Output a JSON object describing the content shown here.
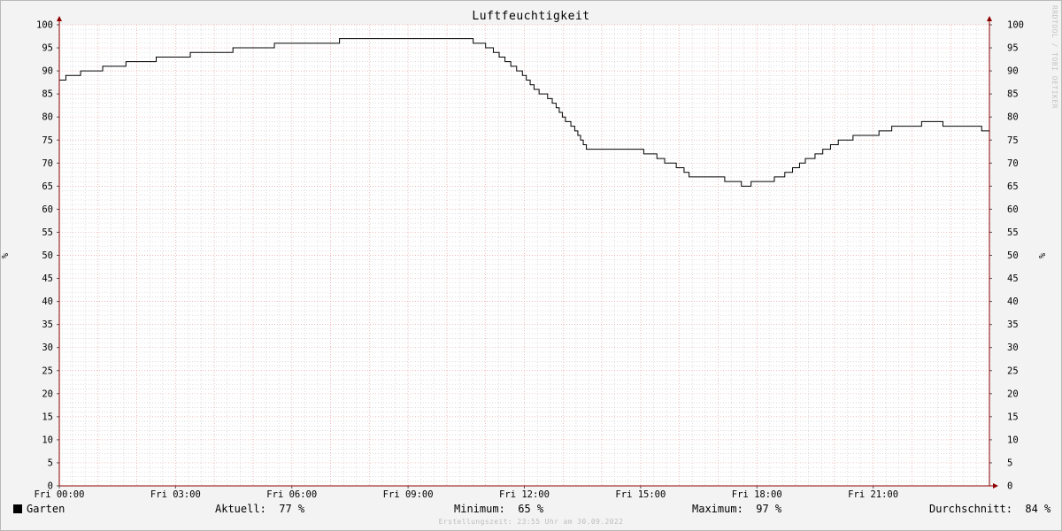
{
  "watermark": "RRDTOOL / TOBI OETIKER",
  "footer": "Erstellungszeit: 23:55 Uhr am 30.09.2022",
  "legend": {
    "series_name": "Garten",
    "current_label": "Aktuell:",
    "current_value": "77 %",
    "min_label": "Minimum:",
    "min_value": "65 %",
    "max_label": "Maximum:",
    "max_value": "97 %",
    "avg_label": "Durchschnitt:",
    "avg_value": "84 %"
  },
  "colors": {
    "line": "#000000",
    "major_grid": "#e9a0a0",
    "minor_grid": "#c8c8c8",
    "axis": "#8c0000",
    "plot_bg": "#ffffff"
  },
  "chart_data": {
    "type": "line",
    "title": "Luftfeuchtigkeit",
    "ylabel": "%",
    "ylabel_right": "%",
    "xlim": [
      0,
      24
    ],
    "ylim": [
      0,
      100
    ],
    "y_ticks": [
      0,
      5,
      10,
      15,
      20,
      25,
      30,
      35,
      40,
      45,
      50,
      55,
      60,
      65,
      70,
      75,
      80,
      85,
      90,
      95,
      100
    ],
    "x_ticks": [
      {
        "x": 0,
        "label": "Fri 00:00"
      },
      {
        "x": 3,
        "label": "Fri 03:00"
      },
      {
        "x": 6,
        "label": "Fri 06:00"
      },
      {
        "x": 9,
        "label": "Fri 09:00"
      },
      {
        "x": 12,
        "label": "Fri 12:00"
      },
      {
        "x": 15,
        "label": "Fri 15:00"
      },
      {
        "x": 18,
        "label": "Fri 18:00"
      },
      {
        "x": 21,
        "label": "Fri 21:00"
      }
    ],
    "grid": true,
    "series": [
      {
        "name": "Garten",
        "step": true,
        "points": [
          [
            0.0,
            88
          ],
          [
            0.17,
            89
          ],
          [
            0.55,
            90
          ],
          [
            1.12,
            91
          ],
          [
            1.72,
            92
          ],
          [
            2.5,
            93
          ],
          [
            3.38,
            94
          ],
          [
            4.48,
            95
          ],
          [
            5.55,
            96
          ],
          [
            7.23,
            97
          ],
          [
            10.68,
            96
          ],
          [
            11.0,
            95
          ],
          [
            11.2,
            94
          ],
          [
            11.35,
            93
          ],
          [
            11.5,
            92
          ],
          [
            11.65,
            91
          ],
          [
            11.8,
            90
          ],
          [
            11.95,
            89
          ],
          [
            12.05,
            88
          ],
          [
            12.15,
            87
          ],
          [
            12.25,
            86
          ],
          [
            12.38,
            85
          ],
          [
            12.6,
            84
          ],
          [
            12.72,
            83
          ],
          [
            12.82,
            82
          ],
          [
            12.9,
            81
          ],
          [
            12.98,
            80
          ],
          [
            13.06,
            79
          ],
          [
            13.2,
            78
          ],
          [
            13.3,
            77
          ],
          [
            13.38,
            76
          ],
          [
            13.45,
            75
          ],
          [
            13.52,
            74
          ],
          [
            13.6,
            73
          ],
          [
            15.08,
            72
          ],
          [
            15.42,
            71
          ],
          [
            15.62,
            70
          ],
          [
            15.92,
            69
          ],
          [
            16.12,
            68
          ],
          [
            16.25,
            67
          ],
          [
            17.17,
            66
          ],
          [
            17.6,
            65
          ],
          [
            17.85,
            66
          ],
          [
            18.45,
            67
          ],
          [
            18.72,
            68
          ],
          [
            18.92,
            69
          ],
          [
            19.1,
            70
          ],
          [
            19.25,
            71
          ],
          [
            19.5,
            72
          ],
          [
            19.7,
            73
          ],
          [
            19.9,
            74
          ],
          [
            20.1,
            75
          ],
          [
            20.48,
            76
          ],
          [
            21.15,
            77
          ],
          [
            21.48,
            78
          ],
          [
            22.25,
            79
          ],
          [
            22.8,
            78
          ],
          [
            23.8,
            77
          ],
          [
            24.0,
            77
          ]
        ]
      }
    ]
  }
}
